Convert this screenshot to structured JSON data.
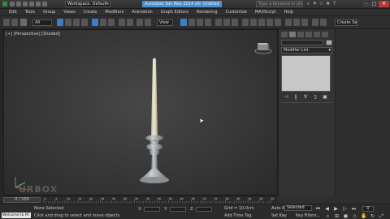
{
  "title_bar": {
    "workspace": "Workspace: Default",
    "document_title": "Autodesk 3ds Max  2014 x64",
    "app_name": "Untitled",
    "search_placeholder": "Type a keyword or phrase"
  },
  "menu": [
    "Edit",
    "Tools",
    "Group",
    "Views",
    "Create",
    "Modifiers",
    "Animation",
    "Graph Editors",
    "Rendering",
    "Customize",
    "MAXScript",
    "Help"
  ],
  "toolbar": {
    "filter": "All",
    "view": "View",
    "create_selection_set": "Create Se"
  },
  "viewport": {
    "label": "[+] [Perspective] [Shaded]",
    "watermark": "URBOX"
  },
  "command_panel": {
    "modifier_list": "Modifier List",
    "stack_tools": [
      "pin-stack-icon",
      "show-end-result-icon",
      "make-unique-icon",
      "remove-modifier-icon",
      "configure-modifier-sets-icon"
    ]
  },
  "timeline": {
    "slider": "0 / 100",
    "ticks": [
      "0",
      "5",
      "10",
      "15",
      "20",
      "25",
      "30",
      "35",
      "40",
      "45",
      "50",
      "55",
      "60",
      "65",
      "70",
      "75",
      "80",
      "85",
      "90",
      "95",
      "100"
    ]
  },
  "status": {
    "maxscript": "Welcome to M:",
    "selection": "None Selected",
    "prompt": "Click and drag to select and move objects",
    "coords": [
      "X:",
      "Y:",
      "Z:"
    ],
    "grid": "Grid = 10.0cm",
    "add_time_tag": "Add Time Tag",
    "auto_key": "Auto Key",
    "selected": "Selected",
    "set_key": "Set Key",
    "key_filters": "Key Filters...",
    "frame": "0"
  },
  "colors": {
    "accent": "#4a8fd0",
    "candle": "#e7e2c6",
    "holder": "#a9adb0"
  }
}
